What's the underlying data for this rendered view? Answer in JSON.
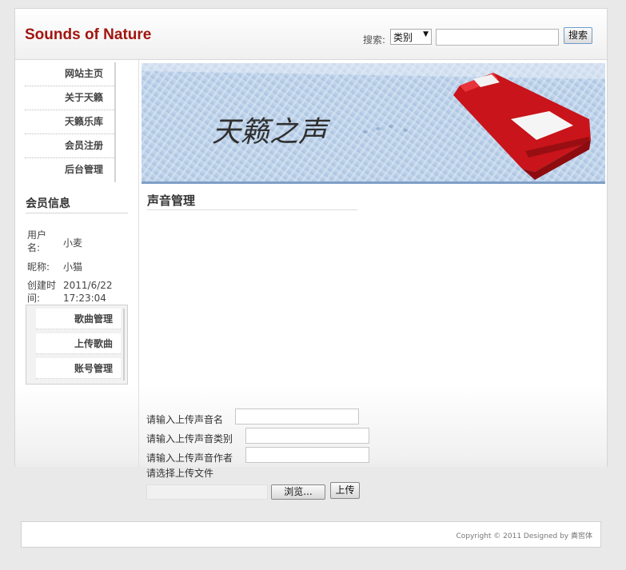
{
  "header": {
    "logo": "Sounds of Nature",
    "search_label": "搜索:",
    "search_category": "类别",
    "search_value": "",
    "search_button": "搜索"
  },
  "nav": {
    "items": [
      {
        "label": "网站主页"
      },
      {
        "label": "关于天籁"
      },
      {
        "label": "天籁乐库"
      },
      {
        "label": "会员注册"
      },
      {
        "label": "后台管理"
      }
    ]
  },
  "member": {
    "title": "会员信息",
    "username_label": "用户名:",
    "username": "小麦",
    "nickname_label": "昵称:",
    "nickname": "小猫",
    "created_label": "创建时间:",
    "created": "2011/6/22 17:23:04"
  },
  "submenu": {
    "items": [
      {
        "label": "歌曲管理"
      },
      {
        "label": "上传歌曲"
      },
      {
        "label": "账号管理"
      }
    ]
  },
  "banner": {
    "text": "天籁之声"
  },
  "main": {
    "title": "声音管理"
  },
  "form": {
    "name_label": "请输入上传声音名",
    "name_value": "",
    "category_label": "请输入上传声音类别",
    "category_value": "",
    "author_label": "请输入上传声音作者",
    "author_value": "",
    "file_label": "请选择上传文件",
    "browse_button": "浏览...",
    "upload_button": "上传"
  },
  "footer": {
    "copyright": "Copyright © 2011 Designed by 粪窖体"
  },
  "colors": {
    "logo": "#a1150f",
    "banner_sky": "#bcd3ea",
    "sofa": "#c8141a"
  }
}
